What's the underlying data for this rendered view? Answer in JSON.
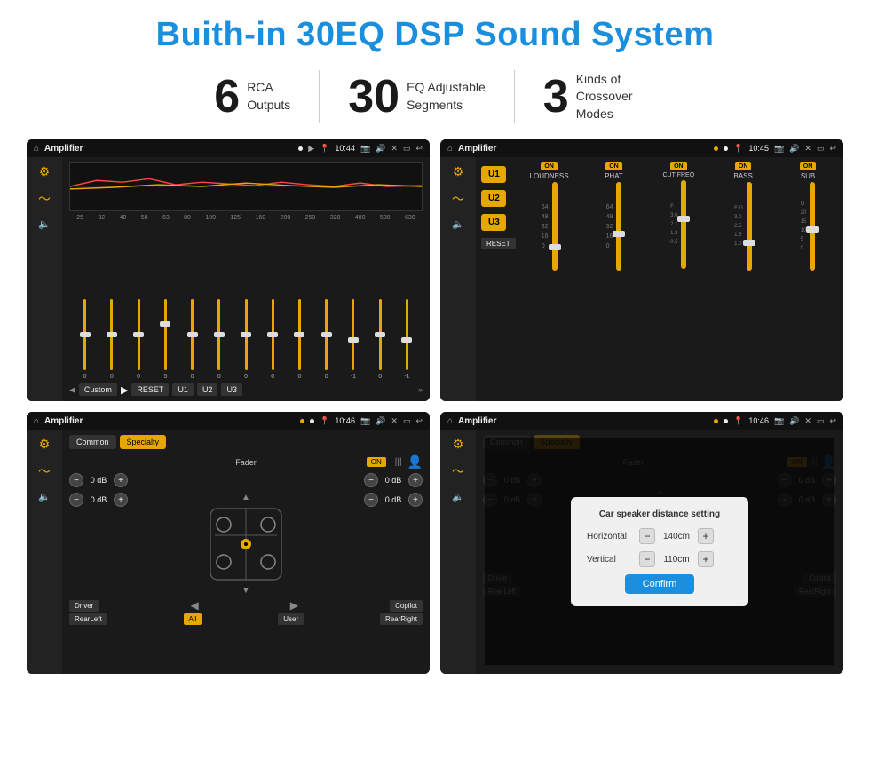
{
  "title": "Buith-in 30EQ DSP Sound System",
  "stats": [
    {
      "number": "6",
      "label": "RCA\nOutputs"
    },
    {
      "number": "30",
      "label": "EQ Adjustable\nSegments"
    },
    {
      "number": "3",
      "label": "Kinds of\nCrossover Modes"
    }
  ],
  "screens": [
    {
      "id": "eq-screen",
      "statusBar": {
        "appName": "Amplifier",
        "time": "10:44"
      },
      "type": "eq"
    },
    {
      "id": "crossover-screen",
      "statusBar": {
        "appName": "Amplifier",
        "time": "10:45"
      },
      "type": "crossover"
    },
    {
      "id": "fader-screen",
      "statusBar": {
        "appName": "Amplifier",
        "time": "10:46"
      },
      "type": "fader"
    },
    {
      "id": "distance-screen",
      "statusBar": {
        "appName": "Amplifier",
        "time": "10:46"
      },
      "type": "distance-dialog"
    }
  ],
  "eq": {
    "frequencies": [
      "25",
      "32",
      "40",
      "50",
      "63",
      "80",
      "100",
      "125",
      "160",
      "200",
      "250",
      "320",
      "400",
      "500",
      "630"
    ],
    "values": [
      "0",
      "0",
      "0",
      "5",
      "0",
      "0",
      "0",
      "0",
      "0",
      "0",
      "-1",
      "0",
      "-1"
    ],
    "preset": "Custom",
    "buttons": [
      "RESET",
      "U1",
      "U2",
      "U3"
    ]
  },
  "crossover": {
    "units": [
      "U1",
      "U2",
      "U3"
    ],
    "channels": [
      {
        "name": "LOUDNESS",
        "on": true
      },
      {
        "name": "PHAT",
        "on": true
      },
      {
        "name": "CUT FREQ",
        "on": true
      },
      {
        "name": "BASS",
        "on": true
      },
      {
        "name": "SUB",
        "on": true
      }
    ],
    "resetLabel": "RESET"
  },
  "fader": {
    "tabs": [
      "Common",
      "Specialty"
    ],
    "activeTab": "Specialty",
    "faderLabel": "Fader",
    "onBadge": "ON",
    "dbValues": [
      "0 dB",
      "0 dB",
      "0 dB",
      "0 dB"
    ],
    "buttons": {
      "driver": "Driver",
      "copilot": "Copilot",
      "rearLeft": "RearLeft",
      "all": "All",
      "user": "User",
      "rearRight": "RearRight"
    }
  },
  "dialog": {
    "title": "Car speaker distance setting",
    "horizontal": {
      "label": "Horizontal",
      "value": "140cm"
    },
    "vertical": {
      "label": "Vertical",
      "value": "110cm"
    },
    "confirmLabel": "Confirm"
  }
}
